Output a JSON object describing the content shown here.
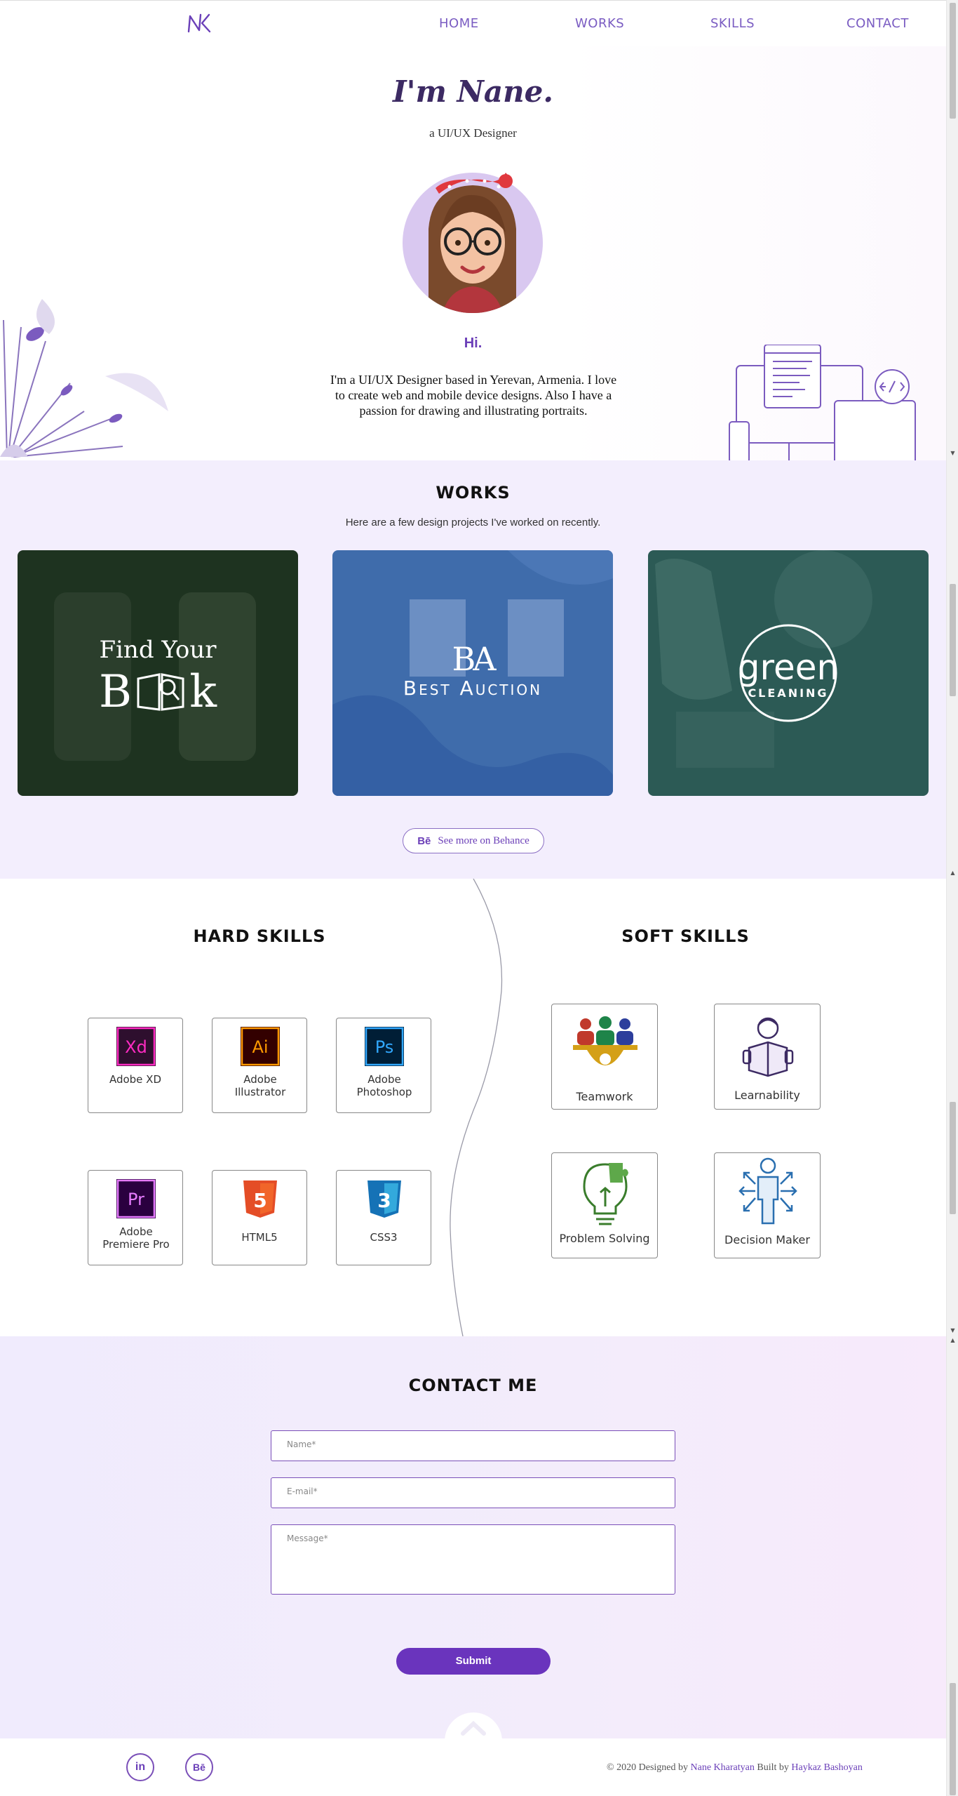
{
  "nav": {
    "logo_text": "NK",
    "links": [
      {
        "label": "HOME"
      },
      {
        "label": "WORKS"
      },
      {
        "label": "SKILLS"
      },
      {
        "label": "CONTACT"
      }
    ]
  },
  "hero": {
    "title": "I'm Nane.",
    "subtitle": "a UI/UX Designer",
    "greeting": "Hi.",
    "intro": "I'm a UI/UX Designer based in Yerevan, Armenia. I love to create web and mobile device designs. Also I have a passion for drawing and illustrating portraits."
  },
  "works": {
    "title": "WORKS",
    "subtitle": "Here are a few design projects I've worked on recently.",
    "projects": [
      {
        "line1": "Find Your",
        "line2": "B",
        "line3": "k",
        "color": "#1e3320"
      },
      {
        "monogram": "BA",
        "name": "Best Auction",
        "color": "#3f6cab"
      },
      {
        "name": "green",
        "tag": "CLEANING",
        "color": "#2c5a55"
      }
    ],
    "behance_icon": "Bē",
    "behance_label": "See more on Behance"
  },
  "skills": {
    "hard_title": "HARD SKILLS",
    "soft_title": "SOFT SKILLS",
    "hard": [
      {
        "abbr": "Xd",
        "label": "Adobe XD",
        "bg": "#2e0f2e",
        "fg": "#ff2bc2"
      },
      {
        "abbr": "Ai",
        "label": "Adobe Illustrator",
        "bg": "#330000",
        "fg": "#ff9a00"
      },
      {
        "abbr": "Ps",
        "label": "Adobe Photoshop",
        "bg": "#001e36",
        "fg": "#31a8ff"
      },
      {
        "abbr": "Pr",
        "label": "Adobe Premiere Pro",
        "bg": "#2a003f",
        "fg": "#e77cff"
      },
      {
        "abbr": "5",
        "label": "HTML5",
        "bg": "#e44d26",
        "fg": "#ffffff"
      },
      {
        "abbr": "3",
        "label": "CSS3",
        "bg": "#1572b6",
        "fg": "#ffffff"
      }
    ],
    "soft": [
      {
        "label": "Teamwork",
        "icon": "teamwork-icon"
      },
      {
        "label": "Learnability",
        "icon": "learnability-icon"
      },
      {
        "label": "Problem Solving",
        "icon": "problem-solving-icon"
      },
      {
        "label": "Decision Maker",
        "icon": "decision-maker-icon"
      }
    ]
  },
  "contact": {
    "title": "CONTACT ME",
    "name_placeholder": "Name*",
    "email_placeholder": "E-mail*",
    "message_placeholder": "Message*",
    "submit_label": "Submit"
  },
  "footer": {
    "linkedin": "in",
    "behance": "Bē",
    "credit_prefix": "© 2020 Designed by",
    "designer": "Nane Kharatyan",
    "credit_mid": "Built by",
    "builder": "Haykaz Bashoyan"
  },
  "colors": {
    "accent": "#6a3fb8",
    "works_bg": "#f3eefd",
    "contact_bg": "#f0ebfd"
  }
}
